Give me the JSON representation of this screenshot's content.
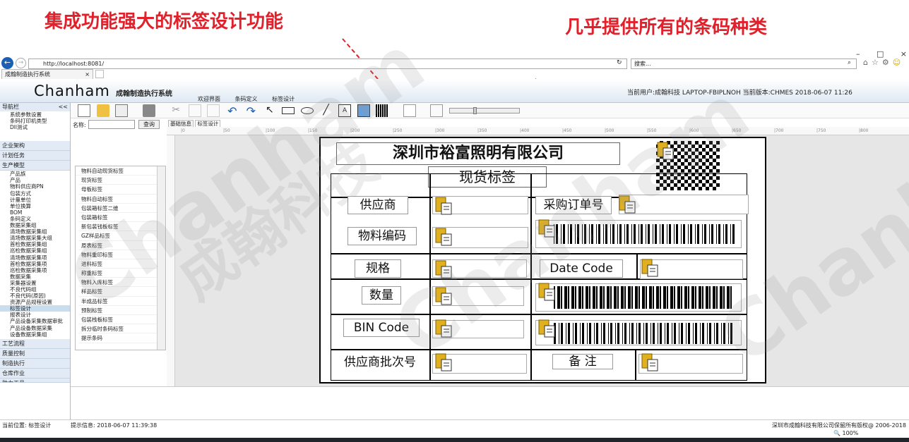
{
  "captions": {
    "left": "集成功能强大的标签设计功能",
    "right": "几乎提供所有的条码种类"
  },
  "watermark": {
    "en": "Chanham",
    "cn": "成翰科技"
  },
  "browser": {
    "url": "http://localhost:8081/",
    "tab_title": "成翰制造执行系统",
    "search_placeholder": "搜索...",
    "window_controls": [
      "–",
      "□",
      "×"
    ],
    "tab_close": "×",
    "refresh": "↻",
    "search_go": "⌕"
  },
  "app": {
    "brand": "Chanham",
    "title": "成翰制造执行系统",
    "menu": [
      "欢迎界面",
      "条码定义",
      "标签设计"
    ],
    "user_info": "当前用户:成翰科技 LAPTOP-FBIPLNOH 当前版本:CHMES 2018-06-07 11:26"
  },
  "sidebar": {
    "header": "导航栏",
    "collapse": "<<",
    "top_items": [
      "系统参数设置",
      "条码打印机类型",
      "Dll测试"
    ],
    "categories_a": [
      "企业架构",
      "计划任务",
      "生产模型"
    ],
    "items": [
      "产品族",
      "产品",
      "物料供应商PN",
      "包装方式",
      "计量单位",
      "单位换算",
      "BOM",
      "条码定义",
      "数据采集组",
      "清场数据采集组",
      "清场数据采集大组",
      "首检数据采集组",
      "巡检数据采集组",
      "清场数据采集项",
      "首检数据采集项",
      "巡检数据采集项",
      "数据采集",
      "采集器设置",
      "不良代码组",
      "不良代码(原因)",
      "资源产品规程设置",
      "标签设计",
      "报表设计",
      "产品设备采集数据审批",
      "产品设备数据采集",
      "设备数据采集组"
    ],
    "selected": "标签设计",
    "categories_b": [
      "工艺流程",
      "质量控制",
      "制造执行",
      "仓库作业",
      "助力工具"
    ]
  },
  "search": {
    "label": "名称:",
    "value": "",
    "button": "查询"
  },
  "sub_tabs": [
    "基础信息",
    "标签设计"
  ],
  "label_list": [
    "物料自动现货标签",
    "现货标签",
    "母板标签",
    "物料自动标签",
    "包装箱标签二维",
    "包装箱标签",
    "新包装钱板标签",
    "GZ样品标签",
    "原表标签",
    "物料重印标签",
    "进料标签",
    "称重标签",
    "物料入库标签",
    "样品标签",
    "半成品标签",
    "预制标签",
    "包装栈板标签",
    "拆分临时条码标签",
    "提示条码"
  ],
  "ruler_marks": [
    "|0",
    "|50",
    "|100",
    "|150",
    "|200",
    "|250",
    "|300",
    "|350",
    "|400",
    "|450",
    "|500",
    "|550",
    "|600",
    "|650",
    "|700",
    "|750",
    "|800"
  ],
  "label_design": {
    "company": "深圳市裕富照明有限公司",
    "title": "现货标签",
    "fields": {
      "supplier": "供应商",
      "po_number": "采购订单号",
      "material_code": "物料编码",
      "spec": "规格",
      "date_code": "Date  Code",
      "quantity": "数量",
      "bin_code": "BIN Code",
      "supplier_lot": "供应商批次号",
      "remark": "备    注"
    }
  },
  "status": {
    "location": "当前位置: 标签设计",
    "info": "提示信息: 2018-06-07 11:39:38",
    "copyright": "深圳市成翰科技有限公司保留所有版权@ 2006-2018",
    "zoom": "🔍 100%"
  },
  "colors": {
    "caption": "#e0202a",
    "header_bg": "#dfe9f3",
    "sidebar_cat": "#e2ebf5"
  }
}
